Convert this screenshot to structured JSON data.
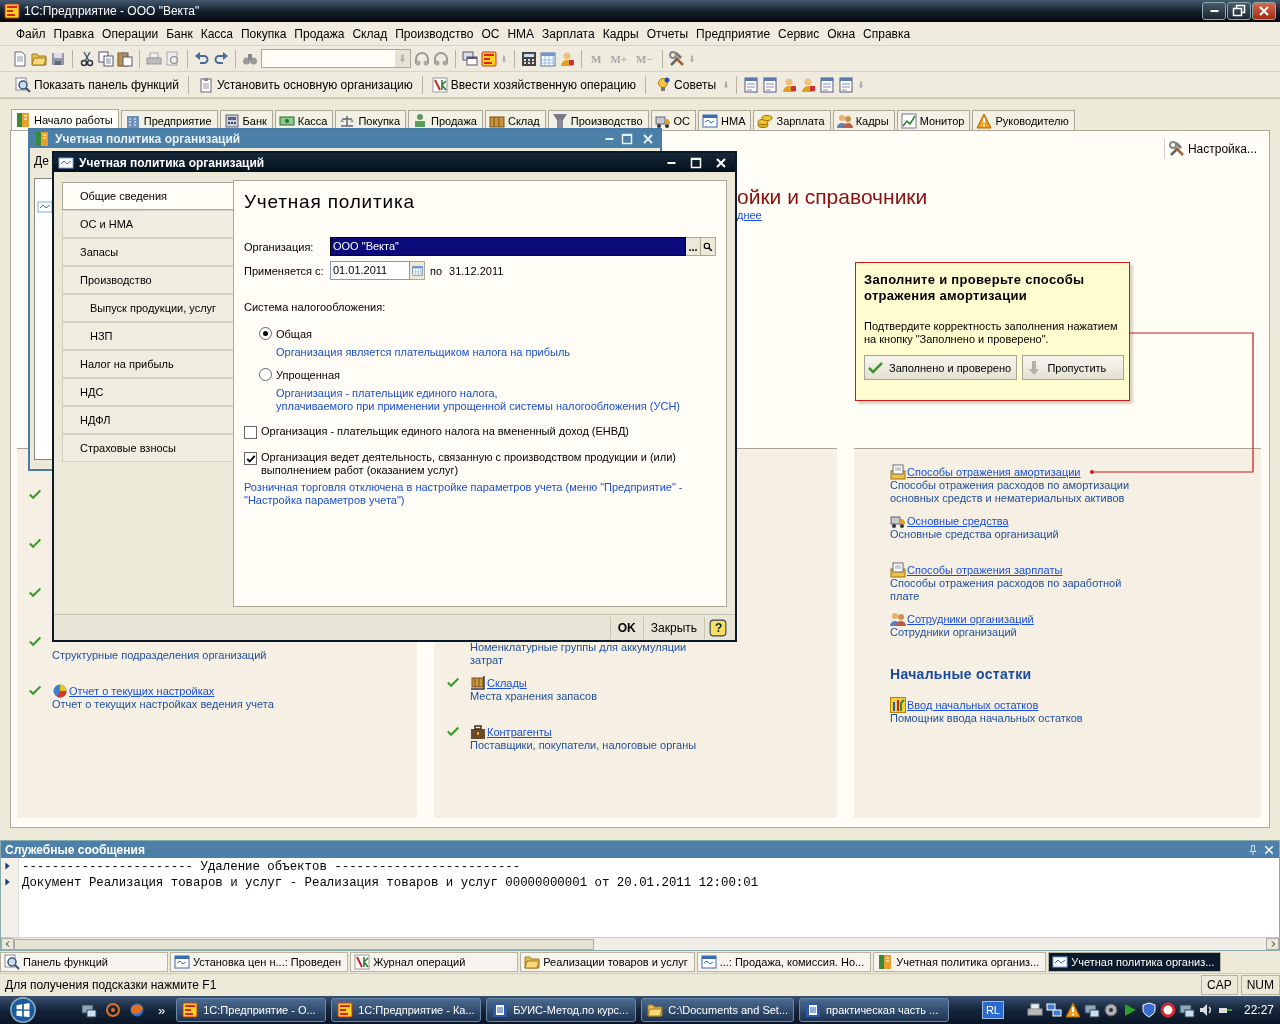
{
  "window": {
    "title": "1С:Предприятие - ООО \"Векта\""
  },
  "menu": [
    "Файл",
    "Правка",
    "Операции",
    "Банк",
    "Касса",
    "Покупка",
    "Продажа",
    "Склад",
    "Производство",
    "ОС",
    "НМА",
    "Зарплата",
    "Кадры",
    "Отчеты",
    "Предприятие",
    "Сервис",
    "Окна",
    "Справка"
  ],
  "memory_buttons": [
    {
      "label": "M",
      "disabled": true
    },
    {
      "label": "M+",
      "disabled": true
    },
    {
      "label": "M−",
      "disabled": true
    }
  ],
  "function_toolbar": [
    "Показать панель функций",
    "Установить основную организацию",
    "Ввести хозяйственную операцию",
    "Советы"
  ],
  "section_tabs": [
    {
      "label": "Начало работы",
      "selected": true
    },
    {
      "label": "Предприятие",
      "selected": false
    },
    {
      "label": "Банк",
      "selected": false
    },
    {
      "label": "Касса",
      "selected": false
    },
    {
      "label": "Покупка",
      "selected": false
    },
    {
      "label": "Продажа",
      "selected": false
    },
    {
      "label": "Склад",
      "selected": false
    },
    {
      "label": "Производство",
      "selected": false
    },
    {
      "label": "ОС",
      "selected": false
    },
    {
      "label": "НМА",
      "selected": false
    },
    {
      "label": "Зарплата",
      "selected": false
    },
    {
      "label": "Кадры",
      "selected": false
    },
    {
      "label": "Монитор",
      "selected": false
    },
    {
      "label": "Руководителю",
      "selected": false
    }
  ],
  "start_page": {
    "settings_button": "Настройка...",
    "heading": "ойки и справочники",
    "more_link": "днее",
    "hint": {
      "title": "Заполните и проверьте способы отражения амортизации",
      "text": "Подтвердите корректность заполнения нажатием на кнопку \"Заполнено и проверено\".",
      "buttons": [
        "Заполнено и проверено",
        "Пропустить"
      ]
    },
    "columns": [
      {
        "groups": [
          {
            "items": [
              {
                "done": true
              },
              {
                "done": true
              },
              {
                "done": true
              },
              {
                "done": true,
                "description": "Структурные подразделения организаций"
              },
              {
                "done": true,
                "link": "Отчет о текущих настройках",
                "description": "Отчет о текущих настройках ведения учета"
              }
            ]
          }
        ]
      },
      {
        "groups": [
          {
            "items": [
              {
                "description": "Номенклатурные группы для аккумуляции затрат"
              },
              {
                "done": true,
                "link": "Склады",
                "description": "Места хранения запасов"
              },
              {
                "done": true,
                "link": "Контрагенты",
                "description": "Поставщики, покупатели, налоговые органы"
              }
            ]
          }
        ]
      },
      {
        "groups": [
          {
            "items": [
              {
                "done": false,
                "link": "Способы отражения амортизации",
                "description": "Способы отражения расходов по амортизации основных средств и нематериальных активов"
              },
              {
                "done": false,
                "link": "Основные средства",
                "description": "Основные средства организаций"
              },
              {
                "done": false,
                "link": "Способы отражения зарплаты",
                "description": "Способы отражения расходов по заработной плате"
              },
              {
                "done": false,
                "link": "Сотрудники организаций",
                "description": "Сотрудники организаций"
              }
            ]
          },
          {
            "heading": "Начальные остатки",
            "items": [
              {
                "done": false,
                "link": "Ввод начальных остатков",
                "description": "Помощник ввода начальных остатков"
              }
            ]
          }
        ]
      }
    ]
  },
  "background_window": {
    "title": "Учетная политика организаций",
    "toolbar_text": "Де"
  },
  "dialog": {
    "title": "Учетная политика организаций",
    "nav": [
      {
        "label": "Общие сведения",
        "selected": true
      },
      {
        "label": "ОС и НМА",
        "selected": false
      },
      {
        "label": "Запасы",
        "selected": false
      },
      {
        "label": "Производство",
        "selected": false,
        "children": [
          {
            "label": "Выпуск продукции, услуг",
            "selected": false
          },
          {
            "label": "НЗП",
            "selected": false
          }
        ]
      },
      {
        "label": "Налог на прибыль",
        "selected": false
      },
      {
        "label": "НДС",
        "selected": false
      },
      {
        "label": "НДФЛ",
        "selected": false
      },
      {
        "label": "Страховые взносы",
        "selected": false
      }
    ],
    "heading": "Учетная политика",
    "organization": {
      "label": "Организация:",
      "value": "ООО \"Векта\"",
      "button": "..."
    },
    "period": {
      "label": "Применяется с:",
      "value": "01.01.2011",
      "to_label": "по",
      "to_value": "31.12.2011"
    },
    "tax_system": {
      "label": "Система налогообложения:",
      "options": [
        {
          "label": "Общая",
          "selected": true,
          "note": "Организация является плательщиком налога на прибыль"
        },
        {
          "label": "Упрощенная",
          "selected": false,
          "note": "Организация - плательщик единого налога,\nуплачиваемого при применении упрощенной системы налогообложения (УСН)"
        }
      ]
    },
    "checkboxes": [
      {
        "label": "Организация - плательщик единого налога на вмененный доход (ЕНВД)",
        "checked": false
      },
      {
        "label": "Организация ведет деятельность, связанную с производством  продукции и (или) выполнением работ (оказанием услуг)",
        "checked": true
      }
    ],
    "note": "Розничная торговля отключена в настройке параметров учета (меню \"Предприятие\" -\n\"Настройка параметров учета\")",
    "buttons": [
      "OK",
      "Закрыть",
      "?"
    ]
  },
  "messages": {
    "title": "Служебные сообщения",
    "lines": [
      "----------------------- Удаление объектов -------------------------",
      "Документ Реализация товаров и услуг - Реализация товаров и услуг 00000000001 от 20.01.2011 12:00:01"
    ]
  },
  "window_tabs": [
    {
      "label": "Панель функций",
      "selected": false
    },
    {
      "label": "Установка цен н...: Проведен",
      "selected": false
    },
    {
      "label": "Журнал операций",
      "selected": false
    },
    {
      "label": "Реализации товаров и услуг",
      "selected": false
    },
    {
      "label": "...: Продажа, комиссия. Но...",
      "selected": false
    },
    {
      "label": "Учетная политика организ...",
      "selected": false
    },
    {
      "label": "Учетная политика организ...",
      "selected": true
    }
  ],
  "status_bar": {
    "text": "Для получения подсказки нажмите F1",
    "indicators": [
      "CAP",
      "NUM"
    ]
  },
  "taskbar": {
    "more": "»",
    "tasks": [
      "1С:Предприятие - О...",
      "1С:Предприятие - Ка...",
      "БУИС-Метод.по курс...",
      "C:\\Documents and Set...",
      "практическая часть ..."
    ],
    "language": "RL",
    "clock": "22:27"
  }
}
